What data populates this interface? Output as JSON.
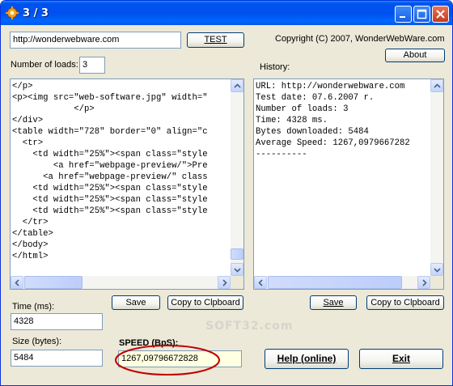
{
  "window": {
    "title": "3 / 3"
  },
  "url_field": {
    "value": "http://wonderwebware.com"
  },
  "test_button": {
    "label": "TEST"
  },
  "copyright": "Copyright (C) 2007, WonderWebWare.com",
  "about_button": {
    "label": "About"
  },
  "loads": {
    "label": "Number of loads:",
    "value": "3"
  },
  "history": {
    "label": "History:"
  },
  "source_lines": [
    "</p>",
    "<p><img src=\"web-software.jpg\" width=\"",
    "            </p>",
    "</div>",
    "<table width=\"728\" border=\"0\" align=\"c",
    "  <tr>",
    "    <td width=\"25%\"><span class=\"style",
    "        <a href=\"webpage-preview/\">Pre",
    "      <a href=\"webpage-preview/\" class",
    "    <td width=\"25%\"><span class=\"style",
    "    <td width=\"25%\"><span class=\"style",
    "    <td width=\"25%\"><span class=\"style",
    "  </tr>",
    "</table>",
    "</body>",
    "</html>"
  ],
  "history_lines": [
    "URL: http://wonderwebware.com",
    "Test date: 07.6.2007 r.",
    "Number of loads: 3",
    "Time: 4328 ms.",
    "Bytes downloaded: 5484",
    "Average Speed: 1267,0979667282",
    "----------"
  ],
  "left_save_button": {
    "label": "Save"
  },
  "left_copy_button": {
    "label": "Copy to Clpboard"
  },
  "right_save_button": {
    "label": "Save"
  },
  "right_copy_button": {
    "label": "Copy to Clpboard"
  },
  "time": {
    "label": "Time (ms):",
    "value": "4328"
  },
  "size": {
    "label": "Size (bytes):",
    "value": "5484"
  },
  "speed": {
    "label": "SPEED (BpS):",
    "value": "1267,09796672828"
  },
  "help_button": {
    "label": "Help (online)"
  },
  "exit_button": {
    "label": "Exit"
  },
  "watermark": "SOFT32.com",
  "colors": {
    "title_bar": "#0054e3",
    "highlight": "#c00000",
    "yellow_field": "#ffffe1"
  }
}
